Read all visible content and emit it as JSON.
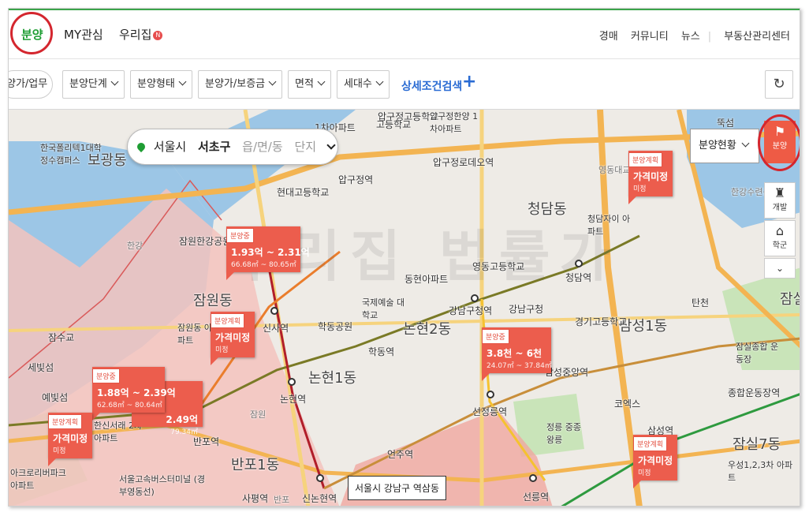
{
  "nav": {
    "tabs": [
      "분양",
      "MY관심",
      "우리집"
    ],
    "new_badge": "N",
    "right_links": [
      "경매",
      "커뮤니티",
      "뉴스",
      "부동산관리센터"
    ]
  },
  "filters": {
    "partial": "양가/업무",
    "items": [
      "분양단계",
      "분양형태",
      "분양가/보증금",
      "면적",
      "세대수"
    ],
    "advanced": "상세조건검색",
    "plus": "+",
    "refresh_icon": "↻"
  },
  "search": {
    "sido": "서울시",
    "gu": "서초구",
    "dong": "읍/면/동",
    "danji": "단지"
  },
  "status_select": "분양현황",
  "side_tools": [
    {
      "label": "분양",
      "icon": "flag-icon"
    },
    {
      "label": "개발",
      "icon": "tower-icon"
    },
    {
      "label": "학군",
      "icon": "school-icon"
    }
  ],
  "markers": [
    {
      "tag": "분양중",
      "price": "1.93억 ~ 2.31억",
      "area": "66.68㎡ ~ 80.65㎡"
    },
    {
      "tag": "분양계획",
      "price": "가격미정",
      "area": "미정"
    },
    {
      "tag": "분양계획",
      "price": "가격미정",
      "area": "미정"
    },
    {
      "tag": "분양중",
      "price": "3.8천 ~ 6천",
      "area": "24.07㎡ ~ 37.84㎡"
    },
    {
      "tag": "분양중",
      "price": "1.88억 ~ 2.39억",
      "area": "62.68㎡ ~ 80.64㎡"
    },
    {
      "tag": "",
      "price": "2.49억",
      "area": "79.34㎡"
    },
    {
      "tag": "분양계획",
      "price": "가격미정",
      "area": "미정"
    },
    {
      "tag": "분양계획",
      "price": "가격미정",
      "area": "미정"
    }
  ],
  "address_box": "서울시 강남구 역삼동",
  "watermark": "우리집 법률가",
  "map_labels": {
    "big": [
      "보광동",
      "잠원동",
      "논현1동",
      "논현2동",
      "청담동",
      "삼성1동",
      "반포1동",
      "잠실7동",
      "잠실"
    ],
    "places": [
      "한국폴리텍1대학 정수캠퍼스",
      "현대고등학교",
      "압구정역",
      "압구정로데오역",
      "영동대교",
      "청담자이 아파트",
      "압구정고등학교",
      "신사역",
      "학동공원",
      "국제예술 대학교",
      "학동역",
      "동현아파트",
      "영동고등학교",
      "강남구청역",
      "강남구청",
      "청담역",
      "경기고등학교",
      "잠원한강공원",
      "한강",
      "잠원동 아파트",
      "잠수교",
      "세빛섬",
      "예빛섬",
      "논현역",
      "잠원",
      "반포역",
      "선정릉역",
      "삼성중앙역",
      "코엑스",
      "정릉 중종왕릉",
      "삼성역",
      "종합운동장역",
      "잠실종합 운동장",
      "우성1,2,3차 아파트",
      "언주역",
      "사평역",
      "반포",
      "신논현역",
      "선릉역",
      "서울고속버스터미널 (경부영동선)",
      "아크로리버파크 아파트",
      "한신서래 2차아파트",
      "탄천",
      "한강수련공원",
      "뚝섬",
      "1차아파트",
      "고등학교",
      "압구정한양 1차아파트"
    ]
  }
}
